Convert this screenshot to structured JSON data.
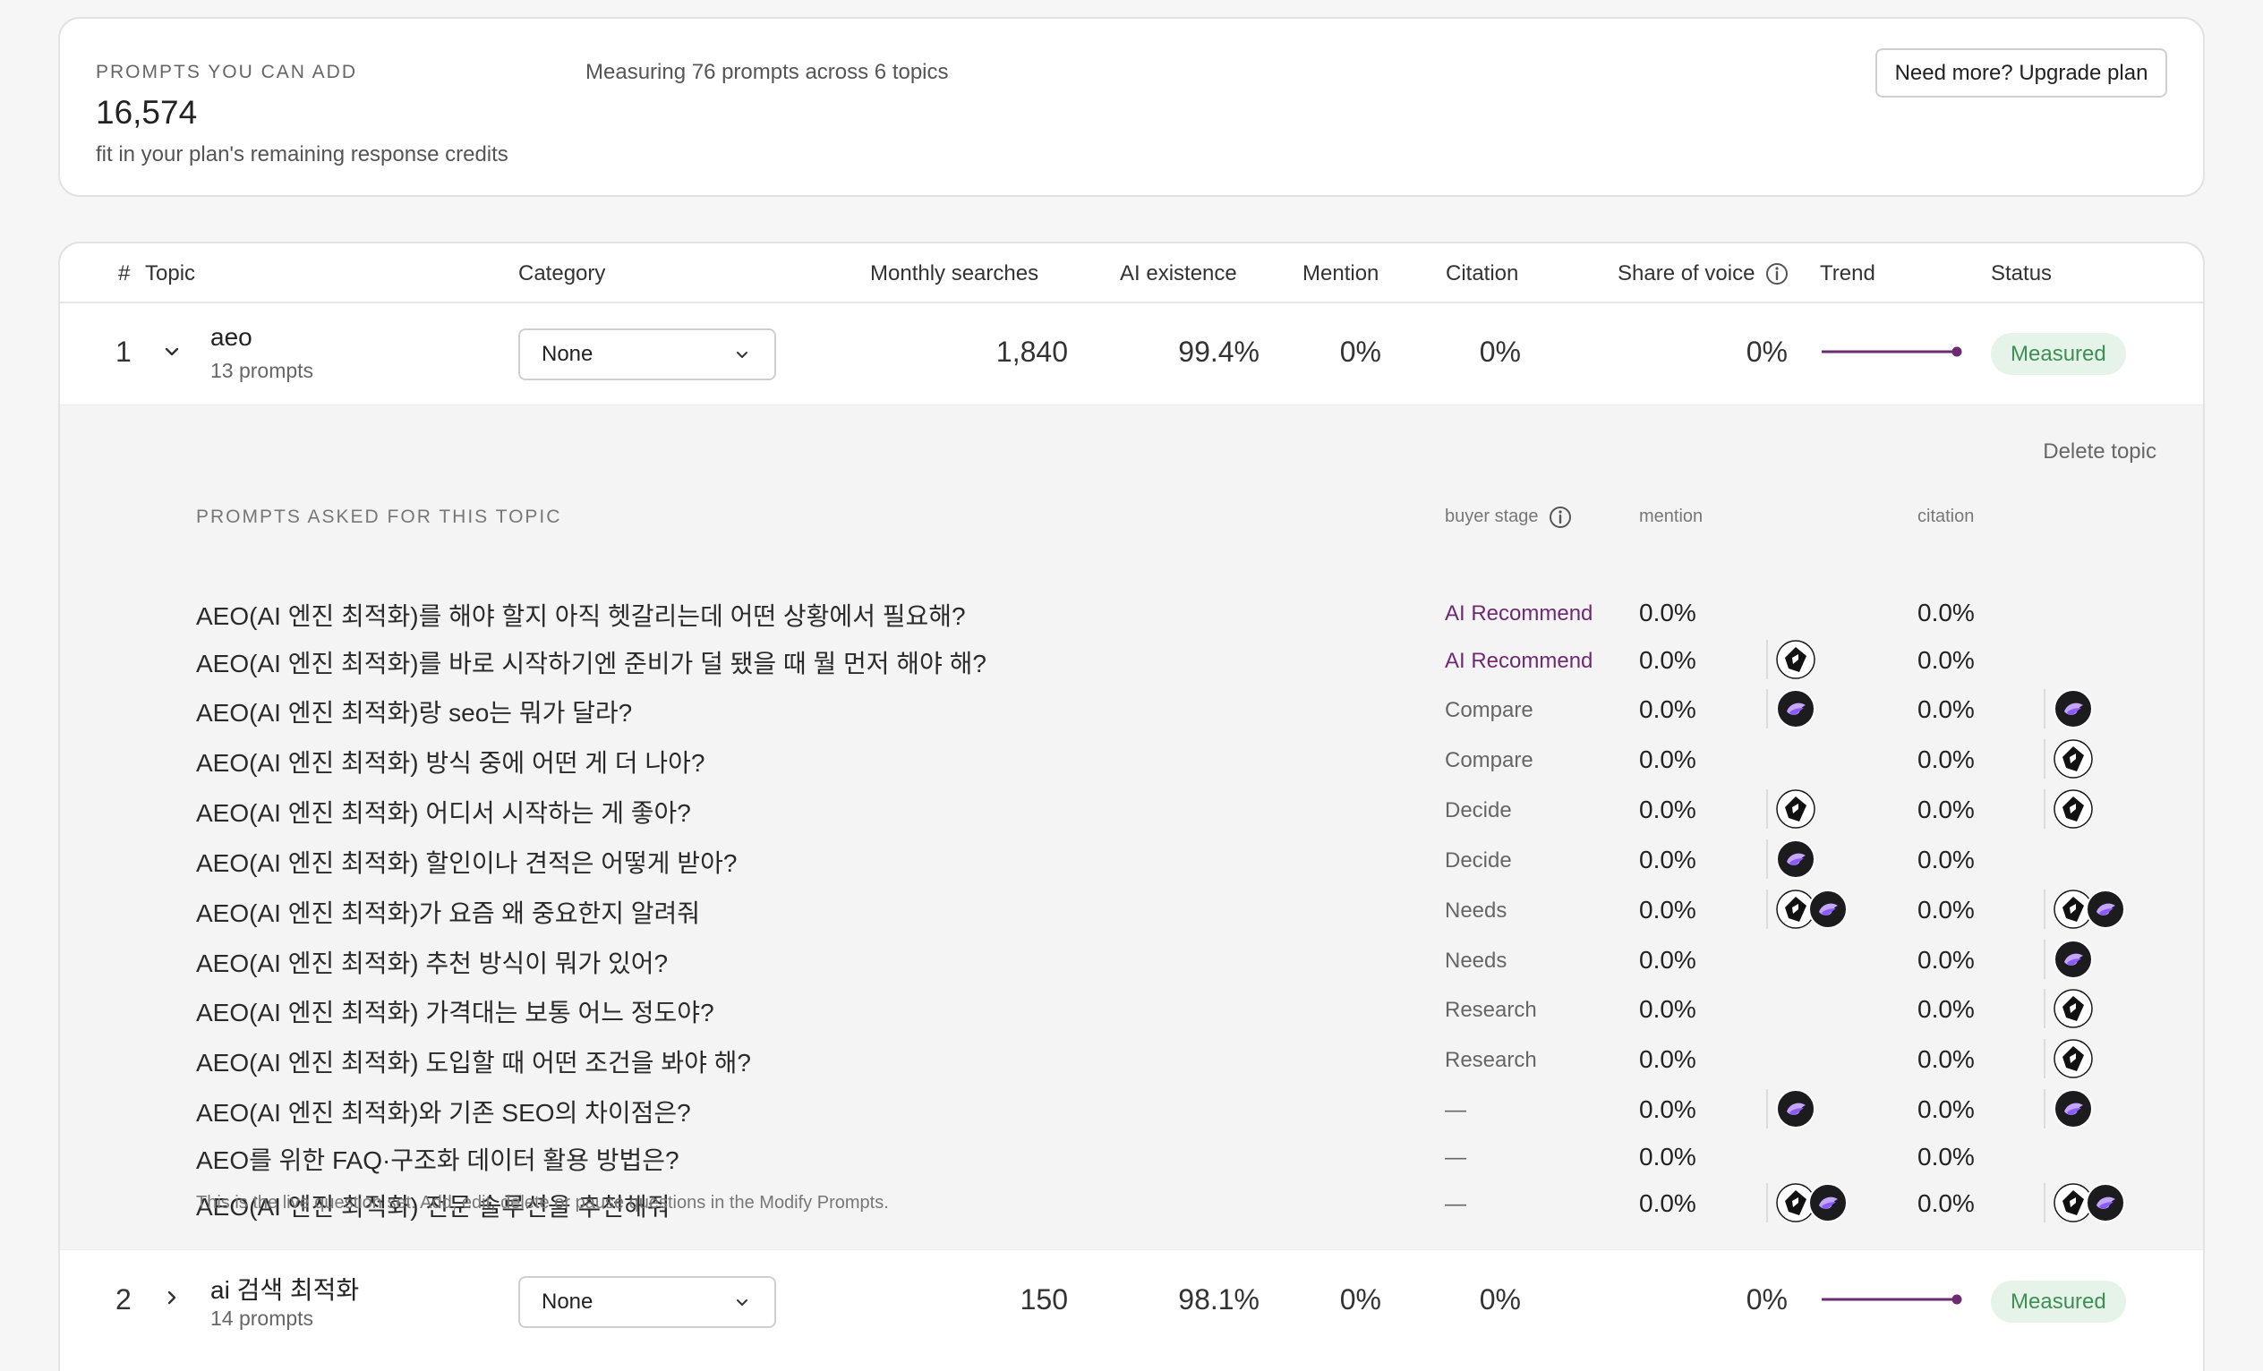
{
  "summary": {
    "eyebrow": "PROMPTS YOU CAN ADD",
    "count": "16,574",
    "sub": "fit in your plan's remaining response credits",
    "measuring": "Measuring 76 prompts across 6 topics",
    "upgrade_label": "Need more? Upgrade plan"
  },
  "table": {
    "headers": {
      "num": "#",
      "topic": "Topic",
      "category": "Category",
      "monthly_searches": "Monthly searches",
      "ai_existence": "AI existence",
      "mention": "Mention",
      "citation": "Citation",
      "share_of_voice": "Share of voice",
      "trend": "Trend",
      "status": "Status"
    },
    "topics": [
      {
        "num": "1",
        "name": "aeo",
        "prompt_count": "13 prompts",
        "category": "None",
        "monthly_searches": "1,840",
        "ai_existence": "99.4%",
        "mention": "0%",
        "citation": "0%",
        "share_of_voice": "0%",
        "status": "Measured",
        "expanded": true
      },
      {
        "num": "2",
        "name": "ai 검색 최적화",
        "prompt_count": "14 prompts",
        "category": "None",
        "monthly_searches": "150",
        "ai_existence": "98.1%",
        "mention": "0%",
        "citation": "0%",
        "share_of_voice": "0%",
        "status": "Measured",
        "expanded": false
      }
    ]
  },
  "expanded_panel": {
    "delete_label": "Delete topic",
    "prompts_header": "PROMPTS ASKED FOR THIS TOPIC",
    "buyer_stage_header": "buyer stage",
    "mention_header": "mention",
    "citation_header": "citation",
    "footnote": "This is the live question set. Add, edit, delete or pause questions in the Modify Prompts.",
    "prompts": [
      {
        "text": "AEO(AI 엔진 최적화)를 해야 할지 아직 헷갈리는데 어떤 상황에서 필요해?",
        "stage": "AI Recommend",
        "mention": "0.0%",
        "citation": "0.0%",
        "mention_icons": [],
        "citation_icons": []
      },
      {
        "text": "AEO(AI 엔진 최적화)를 바로 시작하기엔 준비가 덜 됐을 때 뭘 먼저 해야 해?",
        "stage": "AI Recommend",
        "mention": "0.0%",
        "citation": "0.0%",
        "mention_icons": [
          "perplexity-icon"
        ],
        "citation_icons": []
      },
      {
        "text": "AEO(AI 엔진 최적화)랑 seo는 뭐가 달라?",
        "stage": "Compare",
        "mention": "0.0%",
        "citation": "0.0%",
        "mention_icons": [
          "gemini-icon"
        ],
        "citation_icons": [
          "gemini-icon"
        ]
      },
      {
        "text": "AEO(AI 엔진 최적화) 방식 중에 어떤 게 더 나아?",
        "stage": "Compare",
        "mention": "0.0%",
        "citation": "0.0%",
        "mention_icons": [],
        "citation_icons": [
          "perplexity-icon"
        ]
      },
      {
        "text": "AEO(AI 엔진 최적화) 어디서 시작하는 게 좋아?",
        "stage": "Decide",
        "mention": "0.0%",
        "citation": "0.0%",
        "mention_icons": [
          "perplexity-icon"
        ],
        "citation_icons": [
          "perplexity-icon"
        ]
      },
      {
        "text": "AEO(AI 엔진 최적화) 할인이나 견적은 어떻게 받아?",
        "stage": "Decide",
        "mention": "0.0%",
        "citation": "0.0%",
        "mention_icons": [
          "gemini-icon"
        ],
        "citation_icons": []
      },
      {
        "text": "AEO(AI 엔진 최적화)가 요즘 왜 중요한지 알려줘",
        "stage": "Needs",
        "mention": "0.0%",
        "citation": "0.0%",
        "mention_icons": [
          "perplexity-icon",
          "gemini-icon"
        ],
        "citation_icons": [
          "perplexity-icon",
          "gemini-icon"
        ]
      },
      {
        "text": "AEO(AI 엔진 최적화) 추천 방식이 뭐가 있어?",
        "stage": "Needs",
        "mention": "0.0%",
        "citation": "0.0%",
        "mention_icons": [],
        "citation_icons": [
          "gemini-icon"
        ]
      },
      {
        "text": "AEO(AI 엔진 최적화) 가격대는 보통 어느 정도야?",
        "stage": "Research",
        "mention": "0.0%",
        "citation": "0.0%",
        "mention_icons": [],
        "citation_icons": [
          "perplexity-icon"
        ]
      },
      {
        "text": "AEO(AI 엔진 최적화) 도입할 때 어떤 조건을 봐야 해?",
        "stage": "Research",
        "mention": "0.0%",
        "citation": "0.0%",
        "mention_icons": [],
        "citation_icons": [
          "perplexity-icon"
        ]
      },
      {
        "text": "AEO(AI 엔진 최적화)와 기존 SEO의 차이점은?",
        "stage": "—",
        "mention": "0.0%",
        "citation": "0.0%",
        "mention_icons": [
          "gemini-icon"
        ],
        "citation_icons": [
          "gemini-icon"
        ]
      },
      {
        "text": "AEO를 위한 FAQ·구조화 데이터 활용 방법은?",
        "stage": "—",
        "mention": "0.0%",
        "citation": "0.0%",
        "mention_icons": [],
        "citation_icons": []
      },
      {
        "text": "AEO(AI 엔진 최적화) 전문 솔루션을 추천해줘",
        "stage": "—",
        "mention": "0.0%",
        "citation": "0.0%",
        "mention_icons": [
          "perplexity-icon",
          "gemini-icon"
        ],
        "citation_icons": [
          "perplexity-icon",
          "gemini-icon"
        ]
      }
    ]
  },
  "colors": {
    "accent": "#6d2a72",
    "measured_bg": "#e5f3e8",
    "measured_text": "#3f8f55"
  }
}
